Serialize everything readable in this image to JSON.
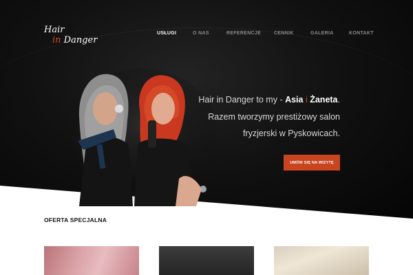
{
  "header": {
    "logo_line1": "Hair",
    "logo_in": "in",
    "logo_line2_rest": "Danger"
  },
  "nav": {
    "items": [
      {
        "label": "USŁUGI",
        "active": true
      },
      {
        "label": "O NAS",
        "active": false
      },
      {
        "label": "REFERENCJE",
        "active": false
      },
      {
        "label": "CENNIK",
        "active": false
      },
      {
        "label": "GALERIA",
        "active": false
      },
      {
        "label": "KONTAKT",
        "active": false
      }
    ]
  },
  "hero": {
    "tagline_prefix": "Hair in Danger to my - ",
    "name1": "Asia",
    "conjunction": " i ",
    "name2": "Żaneta",
    "tagline_period": ".",
    "line2": "Razem tworzymy  prestiżowy salon",
    "line3": "fryzjerski w Pyskowicach.",
    "cta_label": "UMÓW SIĘ NA WIZYTĘ"
  },
  "offer": {
    "title": "OFERTA SPECJALNA"
  },
  "colors": {
    "accent": "#c8451f",
    "hero_bg": "#0a0a0a",
    "text_light": "#d8d8d8"
  }
}
